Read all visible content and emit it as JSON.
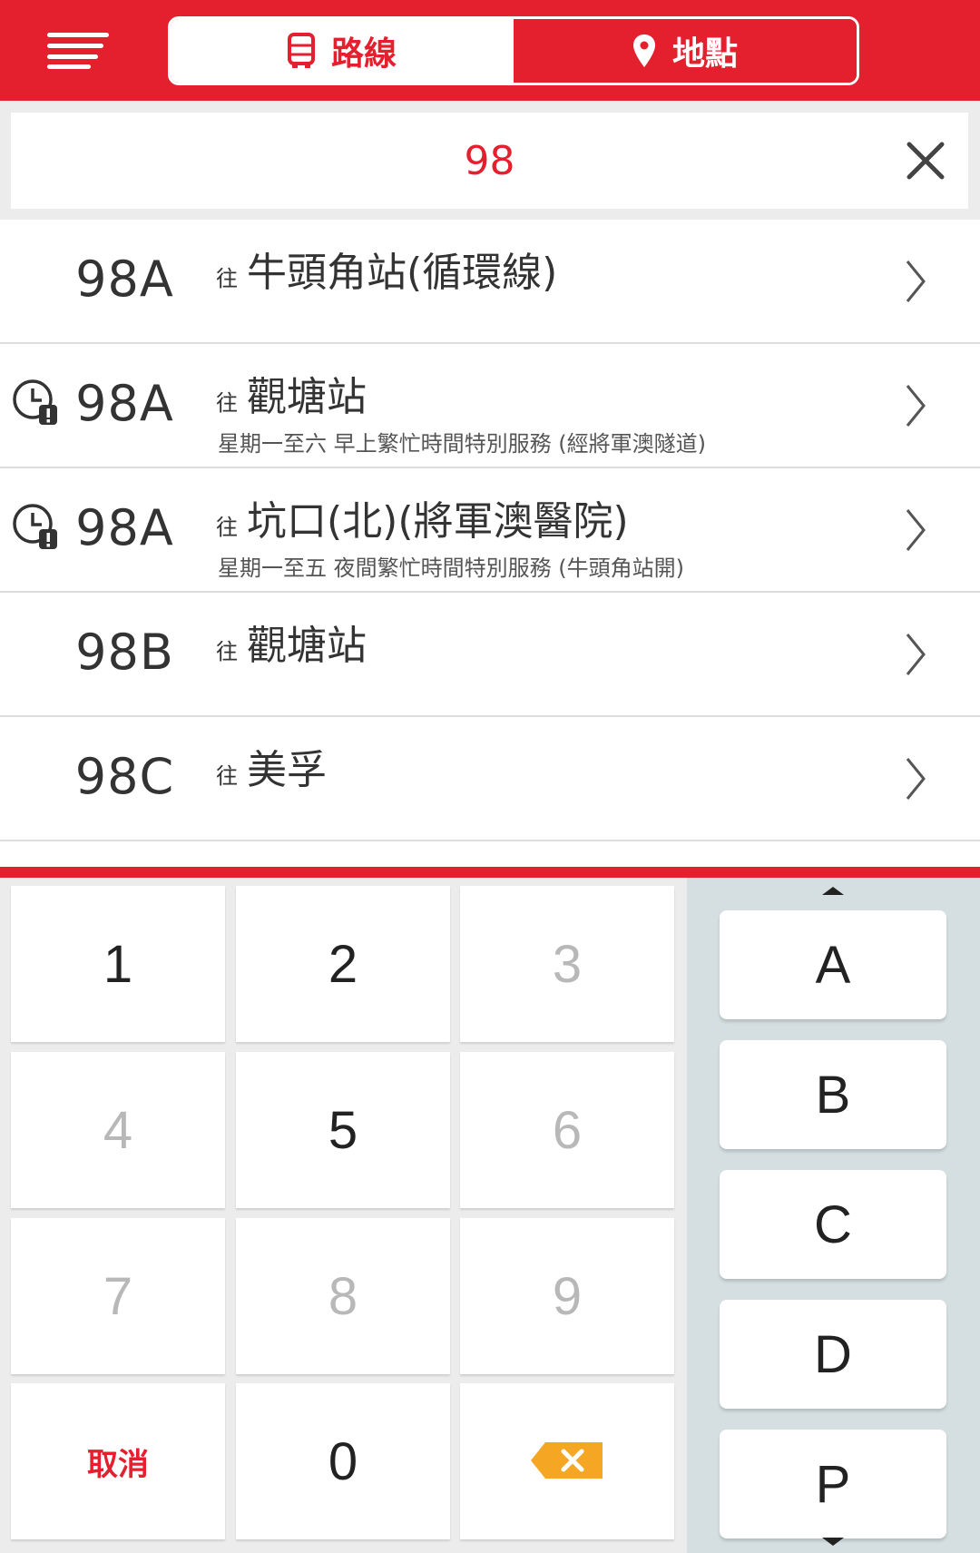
{
  "header": {
    "tabs": [
      {
        "label": "路線",
        "icon": "bus-icon",
        "active": true
      },
      {
        "label": "地點",
        "icon": "location-pin-icon",
        "active": false
      }
    ],
    "menu_icon": "hamburger-menu-icon"
  },
  "search": {
    "value": "98",
    "clear_icon": "close-icon"
  },
  "routes": [
    {
      "route": "98A",
      "prefix": "往",
      "destination": "牛頭角站(循環線)",
      "remark": "",
      "special": false
    },
    {
      "route": "98A",
      "prefix": "往",
      "destination": "觀塘站",
      "remark": "星期一至六 早上繁忙時間特別服務 (經將軍澳隧道)",
      "special": true
    },
    {
      "route": "98A",
      "prefix": "往",
      "destination": "坑口(北)(將軍澳醫院)",
      "remark": "星期一至五 夜間繁忙時間特別服務 (牛頭角站開)",
      "special": true
    },
    {
      "route": "98B",
      "prefix": "往",
      "destination": "觀塘站",
      "remark": "",
      "special": false
    },
    {
      "route": "98C",
      "prefix": "往",
      "destination": "美孚",
      "remark": "",
      "special": false
    }
  ],
  "keypad": {
    "numbers": [
      {
        "label": "1",
        "enabled": true
      },
      {
        "label": "2",
        "enabled": true
      },
      {
        "label": "3",
        "enabled": false
      },
      {
        "label": "4",
        "enabled": false
      },
      {
        "label": "5",
        "enabled": true
      },
      {
        "label": "6",
        "enabled": false
      },
      {
        "label": "7",
        "enabled": false
      },
      {
        "label": "8",
        "enabled": false
      },
      {
        "label": "9",
        "enabled": false
      }
    ],
    "cancel_label": "取消",
    "zero_label": "0",
    "backspace_icon": "backspace-icon",
    "letters": [
      "A",
      "B",
      "C",
      "D",
      "P"
    ]
  },
  "colors": {
    "brand_red": "#e4202f",
    "backspace_orange": "#f5a623",
    "alpha_panel": "#d5dfe1"
  }
}
